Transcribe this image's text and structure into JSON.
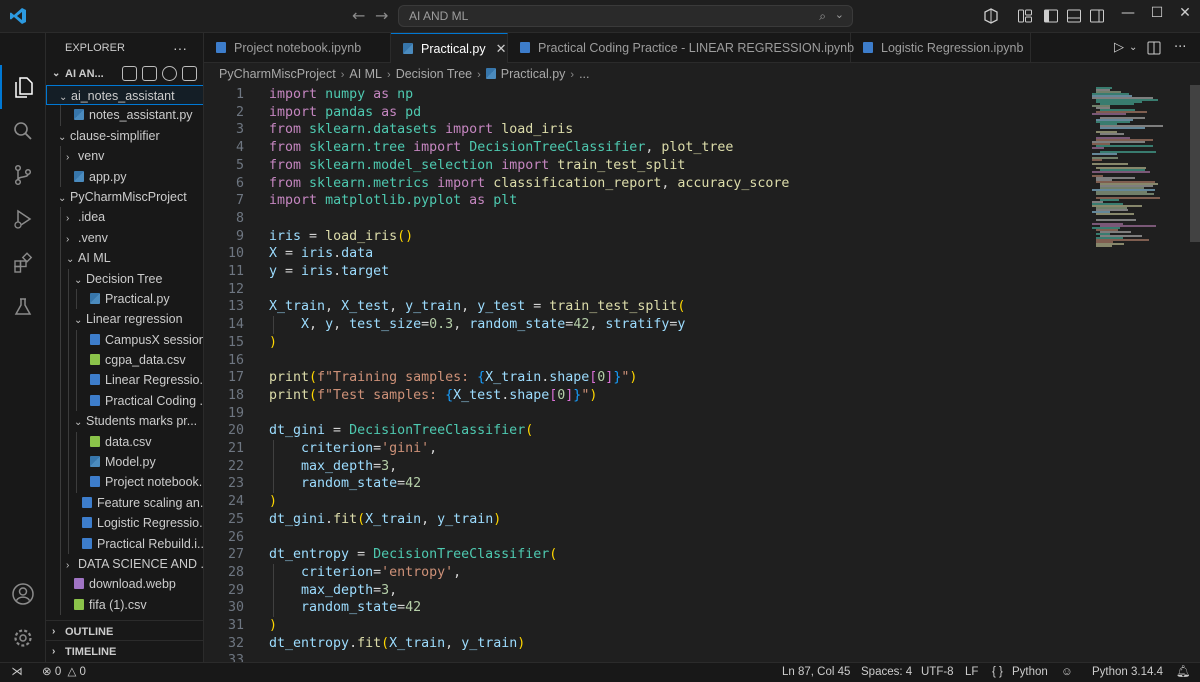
{
  "titlebar": {
    "search_text": "AI AND ML",
    "back_glyph": "←",
    "forward_glyph": "→"
  },
  "explorer": {
    "title": "EXPLORER",
    "more": "···",
    "workspace_label": "AI AN...",
    "tree": [
      {
        "label": "ai_notes_assistant",
        "type": "folder",
        "open": true,
        "depth": 0,
        "selected": true
      },
      {
        "label": "notes_assistant.py",
        "type": "py",
        "depth": 1
      },
      {
        "label": "clause-simplifier",
        "type": "folder",
        "open": true,
        "depth": 0
      },
      {
        "label": "venv",
        "type": "folder",
        "open": false,
        "depth": 1
      },
      {
        "label": "app.py",
        "type": "py",
        "depth": 1
      },
      {
        "label": "PyCharmMiscProject",
        "type": "folder",
        "open": true,
        "depth": 0
      },
      {
        "label": ".idea",
        "type": "folder",
        "open": false,
        "depth": 1
      },
      {
        "label": ".venv",
        "type": "folder",
        "open": false,
        "depth": 1
      },
      {
        "label": "AI ML",
        "type": "folder",
        "open": true,
        "depth": 1
      },
      {
        "label": "Decision Tree",
        "type": "folder",
        "open": true,
        "depth": 2
      },
      {
        "label": "Practical.py",
        "type": "py",
        "depth": 3
      },
      {
        "label": "Linear regression",
        "type": "folder",
        "open": true,
        "depth": 2
      },
      {
        "label": "CampusX session...",
        "type": "nb",
        "depth": 3
      },
      {
        "label": "cgpa_data.csv",
        "type": "csv",
        "depth": 3
      },
      {
        "label": "Linear Regressio...",
        "type": "nb",
        "depth": 3
      },
      {
        "label": "Practical Coding ...",
        "type": "nb",
        "depth": 3
      },
      {
        "label": "Students marks pr...",
        "type": "folder",
        "open": true,
        "depth": 2
      },
      {
        "label": "data.csv",
        "type": "csv",
        "depth": 3
      },
      {
        "label": "Model.py",
        "type": "py",
        "depth": 3
      },
      {
        "label": "Project notebook...",
        "type": "nb",
        "depth": 3
      },
      {
        "label": "Feature scaling an...",
        "type": "nb",
        "depth": 2
      },
      {
        "label": "Logistic Regressio...",
        "type": "nb",
        "depth": 2
      },
      {
        "label": "Practical Rebuild.i...",
        "type": "nb",
        "depth": 2
      },
      {
        "label": "DATA SCIENCE AND ...",
        "type": "folder",
        "open": false,
        "depth": 1
      },
      {
        "label": "download.webp",
        "type": "img",
        "depth": 1
      },
      {
        "label": "fifa (1).csv",
        "type": "csv",
        "depth": 1
      }
    ],
    "outline_label": "OUTLINE",
    "timeline_label": "TIMELINE"
  },
  "tabs": [
    {
      "label": "Project notebook.ipynb",
      "type": "nb",
      "active": false
    },
    {
      "label": "Practical.py",
      "type": "py",
      "active": true
    },
    {
      "label": "Practical Coding Practice - LINEAR REGRESSION.ipynb",
      "type": "nb",
      "active": false
    },
    {
      "label": "Logistic Regression.ipynb",
      "type": "nb",
      "active": false
    }
  ],
  "breadcrumb": [
    "PyCharmMiscProject",
    "AI ML",
    "Decision Tree",
    "Practical.py",
    "..."
  ],
  "code_lines": [
    [
      [
        "kw",
        "import"
      ],
      [
        "def",
        " "
      ],
      [
        "mod",
        "numpy"
      ],
      [
        "def",
        " "
      ],
      [
        "kw",
        "as"
      ],
      [
        "def",
        " "
      ],
      [
        "mod",
        "np"
      ]
    ],
    [
      [
        "kw",
        "import"
      ],
      [
        "def",
        " "
      ],
      [
        "mod",
        "pandas"
      ],
      [
        "def",
        " "
      ],
      [
        "kw",
        "as"
      ],
      [
        "def",
        " "
      ],
      [
        "mod",
        "pd"
      ]
    ],
    [
      [
        "kw",
        "from"
      ],
      [
        "def",
        " "
      ],
      [
        "mod",
        "sklearn.datasets"
      ],
      [
        "def",
        " "
      ],
      [
        "kw",
        "import"
      ],
      [
        "def",
        " "
      ],
      [
        "fn",
        "load_iris"
      ]
    ],
    [
      [
        "kw",
        "from"
      ],
      [
        "def",
        " "
      ],
      [
        "mod",
        "sklearn.tree"
      ],
      [
        "def",
        " "
      ],
      [
        "kw",
        "import"
      ],
      [
        "def",
        " "
      ],
      [
        "mod",
        "DecisionTreeClassifier"
      ],
      [
        "def",
        ", "
      ],
      [
        "fn",
        "plot_tree"
      ]
    ],
    [
      [
        "kw",
        "from"
      ],
      [
        "def",
        " "
      ],
      [
        "mod",
        "sklearn.model_selection"
      ],
      [
        "def",
        " "
      ],
      [
        "kw",
        "import"
      ],
      [
        "def",
        " "
      ],
      [
        "fn",
        "train_test_split"
      ]
    ],
    [
      [
        "kw",
        "from"
      ],
      [
        "def",
        " "
      ],
      [
        "mod",
        "sklearn.metrics"
      ],
      [
        "def",
        " "
      ],
      [
        "kw",
        "import"
      ],
      [
        "def",
        " "
      ],
      [
        "fn",
        "classification_report"
      ],
      [
        "def",
        ", "
      ],
      [
        "fn",
        "accuracy_score"
      ]
    ],
    [
      [
        "kw",
        "import"
      ],
      [
        "def",
        " "
      ],
      [
        "mod",
        "matplotlib.pyplot"
      ],
      [
        "def",
        " "
      ],
      [
        "kw",
        "as"
      ],
      [
        "def",
        " "
      ],
      [
        "mod",
        "plt"
      ]
    ],
    [],
    [
      [
        "var",
        "iris"
      ],
      [
        "def",
        " = "
      ],
      [
        "fn",
        "load_iris"
      ],
      [
        "br1",
        "()"
      ]
    ],
    [
      [
        "var",
        "X"
      ],
      [
        "def",
        " = "
      ],
      [
        "var",
        "iris"
      ],
      [
        "def",
        "."
      ],
      [
        "var",
        "data"
      ]
    ],
    [
      [
        "var",
        "y"
      ],
      [
        "def",
        " = "
      ],
      [
        "var",
        "iris"
      ],
      [
        "def",
        "."
      ],
      [
        "var",
        "target"
      ]
    ],
    [],
    [
      [
        "var",
        "X_train"
      ],
      [
        "def",
        ", "
      ],
      [
        "var",
        "X_test"
      ],
      [
        "def",
        ", "
      ],
      [
        "var",
        "y_train"
      ],
      [
        "def",
        ", "
      ],
      [
        "var",
        "y_test"
      ],
      [
        "def",
        " = "
      ],
      [
        "fn",
        "train_test_split"
      ],
      [
        "br1",
        "("
      ]
    ],
    [
      [
        "def",
        "    "
      ],
      [
        "var",
        "X"
      ],
      [
        "def",
        ", "
      ],
      [
        "var",
        "y"
      ],
      [
        "def",
        ", "
      ],
      [
        "prm",
        "test_size"
      ],
      [
        "def",
        "="
      ],
      [
        "num",
        "0.3"
      ],
      [
        "def",
        ", "
      ],
      [
        "prm",
        "random_state"
      ],
      [
        "def",
        "="
      ],
      [
        "num",
        "42"
      ],
      [
        "def",
        ", "
      ],
      [
        "prm",
        "stratify"
      ],
      [
        "def",
        "="
      ],
      [
        "var",
        "y"
      ]
    ],
    [
      [
        "br1",
        ")"
      ]
    ],
    [],
    [
      [
        "fn",
        "print"
      ],
      [
        "br1",
        "("
      ],
      [
        "str",
        "f\"Training samples: "
      ],
      [
        "br3",
        "{"
      ],
      [
        "var",
        "X_train"
      ],
      [
        "def",
        "."
      ],
      [
        "var",
        "shape"
      ],
      [
        "br2",
        "["
      ],
      [
        "num",
        "0"
      ],
      [
        "br2",
        "]"
      ],
      [
        "br3",
        "}"
      ],
      [
        "str",
        "\""
      ],
      [
        "br1",
        ")"
      ]
    ],
    [
      [
        "fn",
        "print"
      ],
      [
        "br1",
        "("
      ],
      [
        "str",
        "f\"Test samples: "
      ],
      [
        "br3",
        "{"
      ],
      [
        "var",
        "X_test"
      ],
      [
        "def",
        "."
      ],
      [
        "var",
        "shape"
      ],
      [
        "br2",
        "["
      ],
      [
        "num",
        "0"
      ],
      [
        "br2",
        "]"
      ],
      [
        "br3",
        "}"
      ],
      [
        "str",
        "\""
      ],
      [
        "br1",
        ")"
      ]
    ],
    [],
    [
      [
        "var",
        "dt_gini"
      ],
      [
        "def",
        " = "
      ],
      [
        "mod",
        "DecisionTreeClassifier"
      ],
      [
        "br1",
        "("
      ]
    ],
    [
      [
        "def",
        "    "
      ],
      [
        "prm",
        "criterion"
      ],
      [
        "def",
        "="
      ],
      [
        "str",
        "'gini'"
      ],
      [
        "def",
        ","
      ]
    ],
    [
      [
        "def",
        "    "
      ],
      [
        "prm",
        "max_depth"
      ],
      [
        "def",
        "="
      ],
      [
        "num",
        "3"
      ],
      [
        "def",
        ","
      ]
    ],
    [
      [
        "def",
        "    "
      ],
      [
        "prm",
        "random_state"
      ],
      [
        "def",
        "="
      ],
      [
        "num",
        "42"
      ]
    ],
    [
      [
        "br1",
        ")"
      ]
    ],
    [
      [
        "var",
        "dt_gini"
      ],
      [
        "def",
        "."
      ],
      [
        "fn",
        "fit"
      ],
      [
        "br1",
        "("
      ],
      [
        "var",
        "X_train"
      ],
      [
        "def",
        ", "
      ],
      [
        "var",
        "y_train"
      ],
      [
        "br1",
        ")"
      ]
    ],
    [],
    [
      [
        "var",
        "dt_entropy"
      ],
      [
        "def",
        " = "
      ],
      [
        "mod",
        "DecisionTreeClassifier"
      ],
      [
        "br1",
        "("
      ]
    ],
    [
      [
        "def",
        "    "
      ],
      [
        "prm",
        "criterion"
      ],
      [
        "def",
        "="
      ],
      [
        "str",
        "'entropy'"
      ],
      [
        "def",
        ","
      ]
    ],
    [
      [
        "def",
        "    "
      ],
      [
        "prm",
        "max_depth"
      ],
      [
        "def",
        "="
      ],
      [
        "num",
        "3"
      ],
      [
        "def",
        ","
      ]
    ],
    [
      [
        "def",
        "    "
      ],
      [
        "prm",
        "random_state"
      ],
      [
        "def",
        "="
      ],
      [
        "num",
        "42"
      ]
    ],
    [
      [
        "br1",
        ")"
      ]
    ],
    [
      [
        "var",
        "dt_entropy"
      ],
      [
        "def",
        "."
      ],
      [
        "fn",
        "fit"
      ],
      [
        "br1",
        "("
      ],
      [
        "var",
        "X_train"
      ],
      [
        "def",
        ", "
      ],
      [
        "var",
        "y_train"
      ],
      [
        "br1",
        ")"
      ]
    ],
    []
  ],
  "statusbar": {
    "errors": "0",
    "warnings": "0",
    "position": "Ln 87, Col 45",
    "spaces": "Spaces: 4",
    "encoding": "UTF-8",
    "eol": "LF",
    "braces": "{ }",
    "language": "Python",
    "interpreter": "Python 3.14.4"
  },
  "colors": {
    "accent": "#0078d4",
    "keyword": "#c586c0",
    "type": "#4ec9b0",
    "function": "#dcdcaa",
    "variable": "#9cdcfe",
    "string": "#ce9178",
    "number": "#b5cea8"
  }
}
